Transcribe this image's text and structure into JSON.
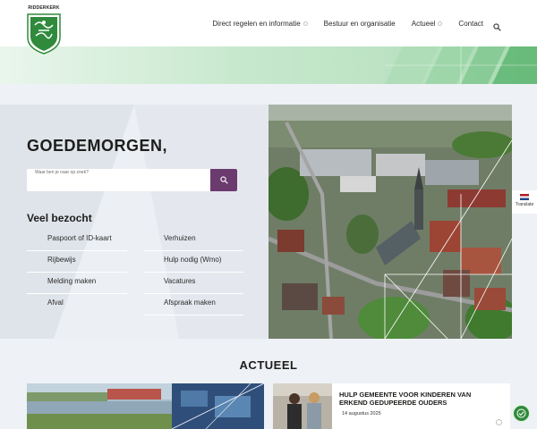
{
  "logo": {
    "text": "RIDDERKERK"
  },
  "nav": {
    "items": [
      {
        "label": "Direct regelen en informatie"
      },
      {
        "label": "Bestuur en organisatie"
      },
      {
        "label": "Actueel"
      },
      {
        "label": "Contact"
      }
    ],
    "search_icon": "search-icon"
  },
  "hero": {
    "greeting": "GOEDEMORGEN,",
    "search": {
      "label": "Waar ben je naar op zoek?",
      "value": ""
    },
    "visited_title": "Veel bezocht",
    "visited": [
      {
        "label": "Paspoort of ID-kaart"
      },
      {
        "label": "Verhuizen"
      },
      {
        "label": "Rijbewijs"
      },
      {
        "label": "Hulp nodig (Wmo)"
      },
      {
        "label": "Melding maken"
      },
      {
        "label": "Vacatures"
      },
      {
        "label": "Afval"
      },
      {
        "label": "Afspraak maken"
      }
    ]
  },
  "translate": {
    "label": "Translate"
  },
  "news": {
    "title": "ACTUEEL",
    "items": [
      {
        "headline": "HULP GEMEENTE VOOR KINDEREN VAN ERKEND GEDUPEERDE OUDERS",
        "date": "14 augustus 2025"
      }
    ]
  },
  "colors": {
    "accent": "#6b3a6e",
    "brand_green": "#2f8a3c",
    "band_green": "#bde3c4"
  }
}
